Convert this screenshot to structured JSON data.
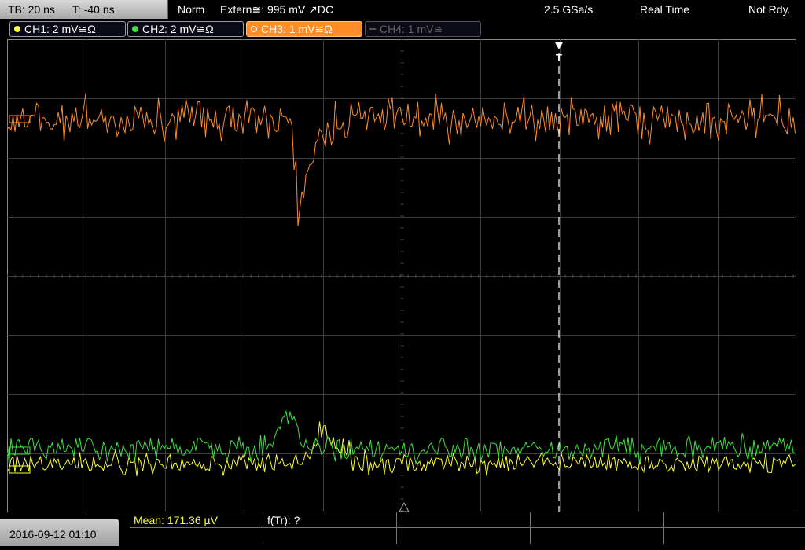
{
  "status_bar": {
    "timebase": "TB: 20 ns",
    "trigger_offset": "T: -40 ns",
    "trigger_mode": "Norm",
    "trigger_source": "Extern≅: 995 mV ↗DC",
    "sample_rate": "2.5 GSa/s",
    "acquisition": "Real Time",
    "state": "Not Rdy."
  },
  "channels": [
    {
      "label": "CH1: 2 mV≅Ω",
      "color": "#ffff30",
      "state": "enabled"
    },
    {
      "label": "CH2: 2 mV≅Ω",
      "color": "#40e040",
      "state": "enabled"
    },
    {
      "label": "CH3: 1 mV≅Ω",
      "color": "#ff8c28",
      "state": "active"
    },
    {
      "label": "CH4: 1 mV≅",
      "color": "#555555",
      "state": "off"
    }
  ],
  "trigger_marker": "T",
  "measurements": {
    "mean": "Mean: 171.36 µV",
    "frequency": "f(Tr): ?"
  },
  "datetime": "2016-09-12 01:10",
  "colors": {
    "ch1": "#ffff30",
    "ch2": "#40e040",
    "ch3": "#ff8c28",
    "grid": "#3a3a3a",
    "trigger_line": "#ffffff"
  }
}
